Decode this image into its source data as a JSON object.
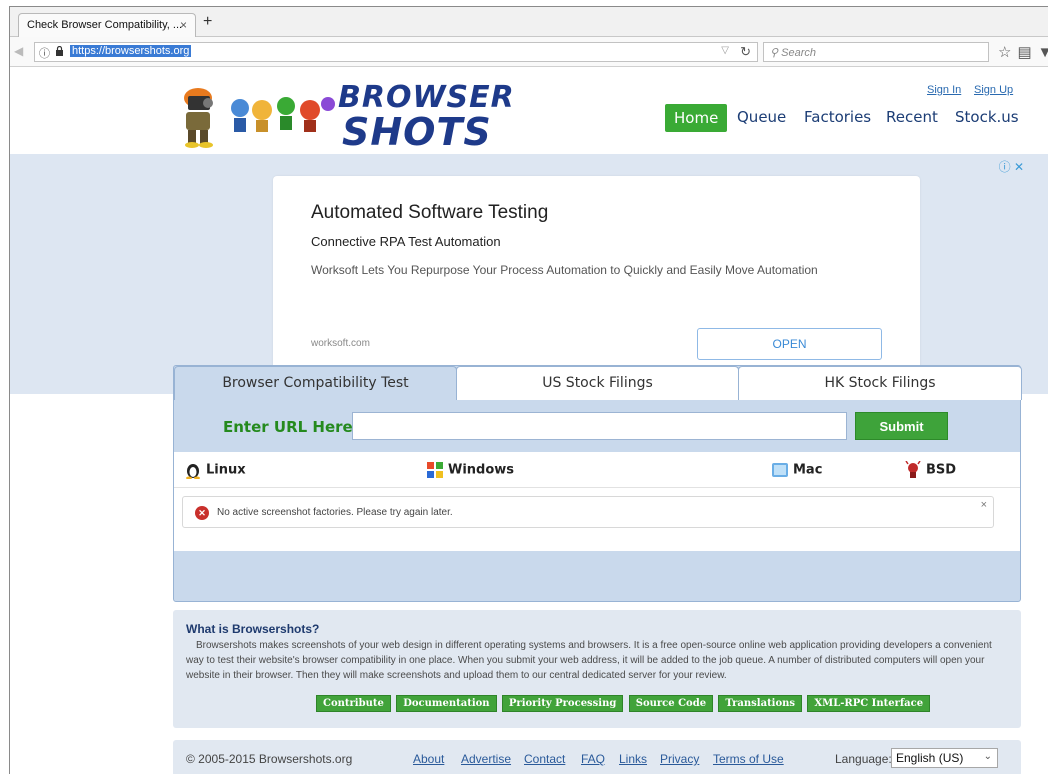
{
  "browser": {
    "tab_title": "Check Browser Compatibility, ...",
    "tab_close": "×",
    "new_tab": "+",
    "url": "https://browsershots.org",
    "search_placeholder": "Search"
  },
  "site": {
    "logo_top": "BROWSER",
    "logo_bottom": "SHOTS",
    "sign_in": "Sign In",
    "sign_up": "Sign Up",
    "nav": [
      "Home",
      "Queue",
      "Factories",
      "Recent",
      "Stock.us"
    ]
  },
  "ad": {
    "title": "Automated Software Testing",
    "subtitle": "Connective RPA Test Automation",
    "description": "Worksoft Lets You Repurpose Your Process Automation to Quickly and Easily Move Automation",
    "domain": "worksoft.com",
    "button": "OPEN"
  },
  "panel": {
    "tabs": [
      "Browser Compatibility Test",
      "US Stock Filings",
      "HK Stock Filings"
    ],
    "url_label": "Enter URL Here:",
    "submit": "Submit",
    "os": [
      "Linux",
      "Windows",
      "Mac",
      "BSD"
    ],
    "alert": "No active screenshot factories. Please try again later.",
    "alert_close": "×"
  },
  "about": {
    "title": "What is Browsershots?",
    "text": "Browsershots makes screenshots of your web design in different operating systems and browsers. It is a free open-source online web application providing developers a convenient way to test their website's browser compatibility in one place. When you submit your web address, it will be added to the job queue. A number of distributed computers will open your website in their browser. Then they will make screenshots and upload them to our central dedicated server for your review.",
    "buttons": [
      "Contribute",
      "Documentation",
      "Priority Processing",
      "Source Code",
      "Translations",
      "XML-RPC Interface"
    ]
  },
  "footer": {
    "copyright": "© 2005-2015 Browsershots.org",
    "links": [
      "About",
      "Advertise",
      "Contact",
      "FAQ",
      "Links",
      "Privacy",
      "Terms of Use"
    ],
    "language_label": "Language:",
    "language_value": "English (US)"
  },
  "colors": {
    "accent_green": "#3aaa35",
    "brand_blue": "#1e3a8a",
    "panel_blue": "#c9d9ec"
  }
}
